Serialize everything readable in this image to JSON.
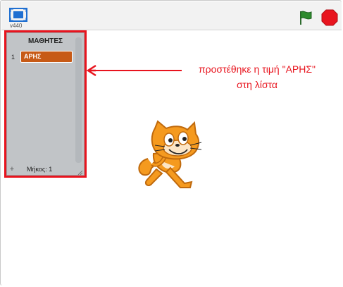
{
  "topbar": {
    "version": "v440",
    "fullscreen_icon": "fullscreen-icon",
    "flag_icon": "green-flag-icon",
    "stop_icon": "stop-sign-icon",
    "flag_color": "#2e8b2e",
    "stop_color": "#e8141e"
  },
  "list_monitor": {
    "title": "ΜΑΘΗΤΕΣ",
    "items": [
      {
        "index": "1",
        "value": "ΑΡΗΣ"
      }
    ],
    "length_label": "Μήκος: 1",
    "add_icon": "+",
    "item_color": "#c75a16"
  },
  "annotation": {
    "line1": "προστέθηκε η τιμή \"ΑΡΗΣ\"",
    "line2": "στη λίστα",
    "color": "#e8141e"
  },
  "stage": {
    "sprite": "scratch-cat"
  }
}
